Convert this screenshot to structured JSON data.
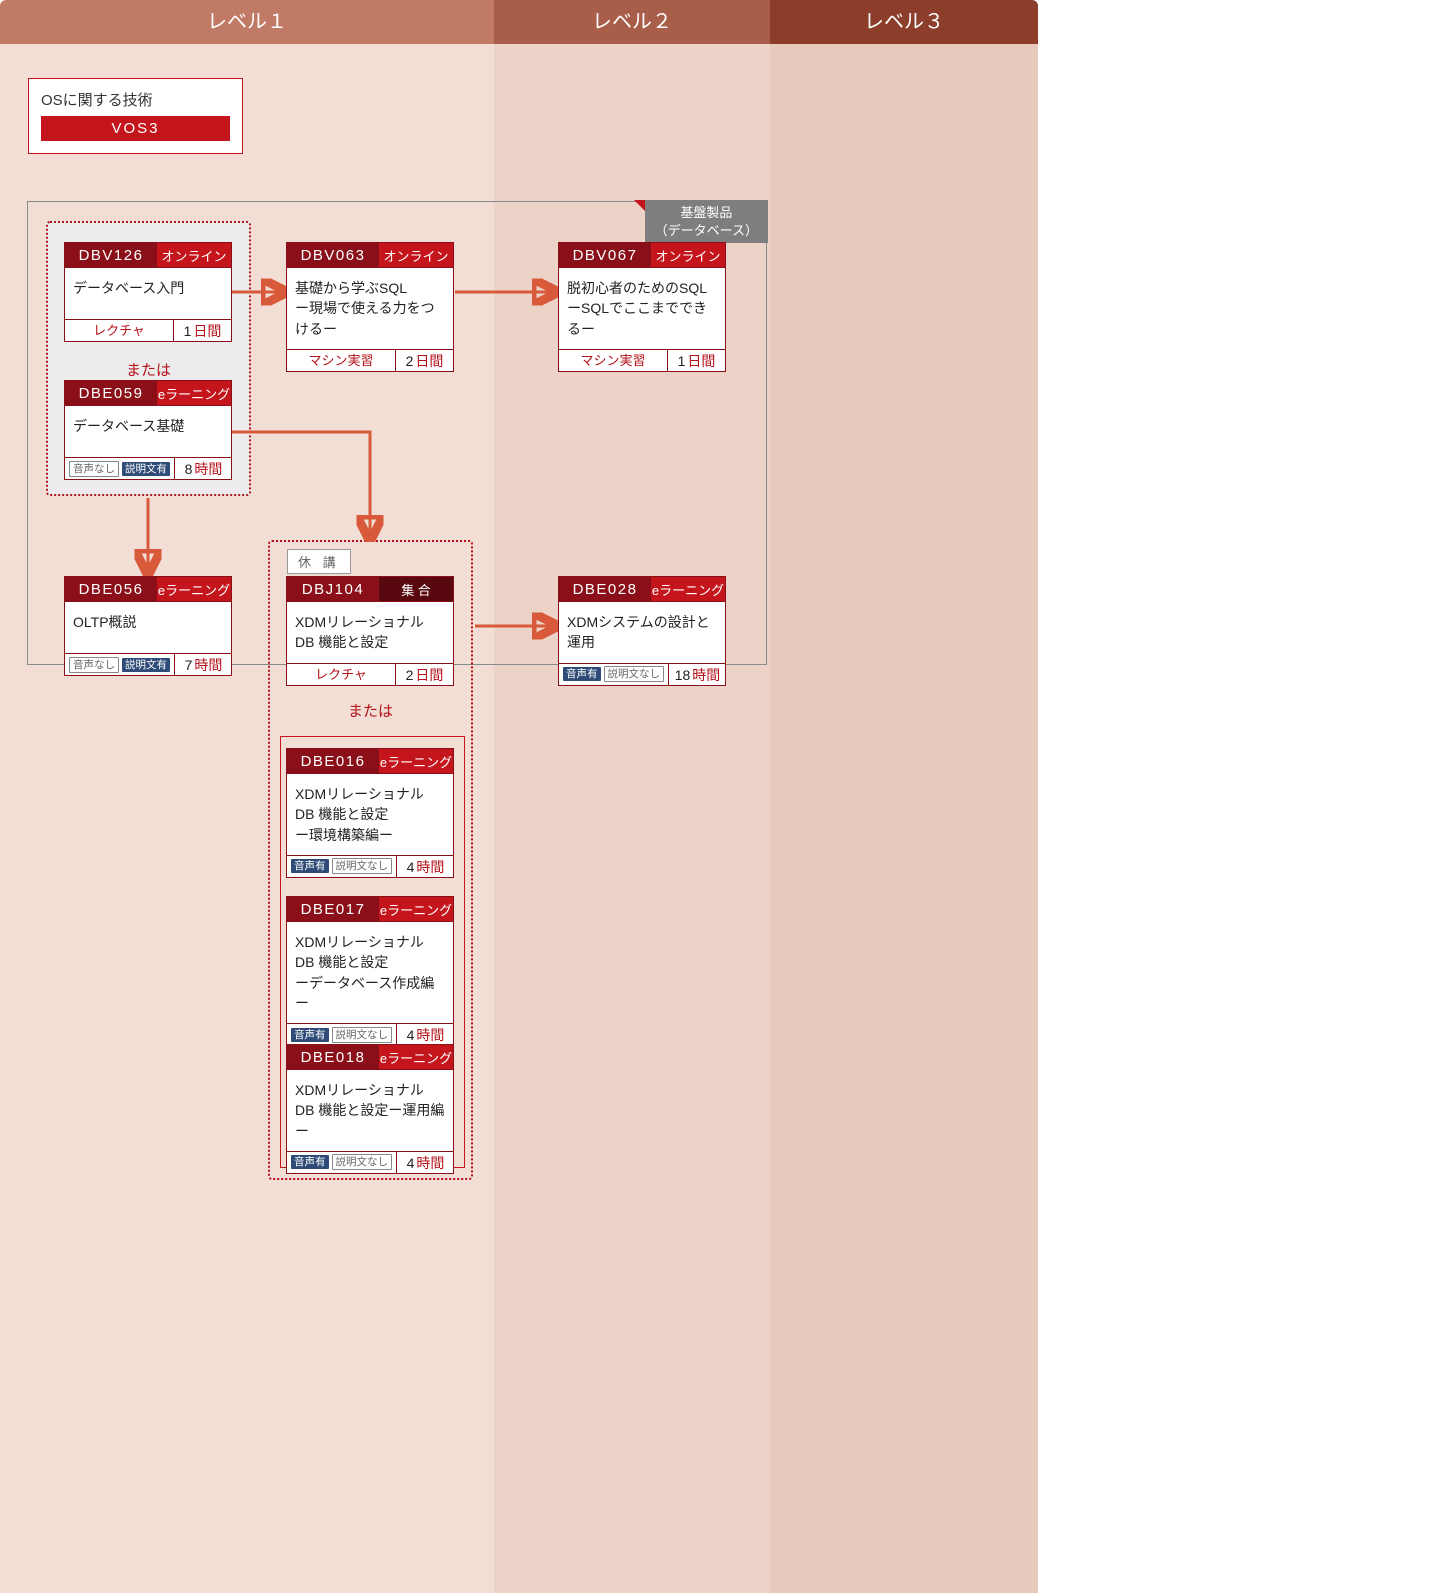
{
  "levels": {
    "l1": "レベル１",
    "l2": "レベル２",
    "l3": "レベル３"
  },
  "os_box": {
    "title": "OSに関する技術",
    "tag": "VOS3"
  },
  "container_label": {
    "line1": "基盤製品",
    "line2": "（データベース）"
  },
  "or_label": "または",
  "status_suspended": "休 講",
  "duration_units": {
    "days": "日間",
    "hours": "時間"
  },
  "cards": {
    "dbv126": {
      "code": "DBV126",
      "mode": "オンライン",
      "title": "データベース入門",
      "style": "レクチャ",
      "dur_n": "1",
      "dur_u": "days"
    },
    "dbe059": {
      "code": "DBE059",
      "mode": "eラーニング",
      "title": "データベース基礎",
      "audio": "none",
      "text": "yes",
      "dur_n": "8",
      "dur_u": "hours"
    },
    "dbv063": {
      "code": "DBV063",
      "mode": "オンライン",
      "title": "基礎から学ぶSQL\nー現場で使える力をつけるー",
      "style": "マシン実習",
      "dur_n": "2",
      "dur_u": "days"
    },
    "dbv067": {
      "code": "DBV067",
      "mode": "オンライン",
      "title": "脱初心者のためのSQL\nーSQLでここまでできるー",
      "style": "マシン実習",
      "dur_n": "1",
      "dur_u": "days"
    },
    "dbe056": {
      "code": "DBE056",
      "mode": "eラーニング",
      "title": "OLTP概説",
      "audio": "none",
      "text": "yes",
      "dur_n": "7",
      "dur_u": "hours"
    },
    "dbj104": {
      "code": "DBJ104",
      "mode": "集 合",
      "title": "XDMリレーショナル\nDB 機能と設定",
      "style": "レクチャ",
      "dur_n": "2",
      "dur_u": "days"
    },
    "dbe028": {
      "code": "DBE028",
      "mode": "eラーニング",
      "title": "XDMシステムの設計と運用",
      "audio": "yes",
      "text": "none",
      "dur_n": "18",
      "dur_u": "hours"
    },
    "dbe016": {
      "code": "DBE016",
      "mode": "eラーニング",
      "title": "XDMリレーショナル\nDB 機能と設定\nー環境構築編ー",
      "audio": "yes",
      "text": "none",
      "dur_n": "4",
      "dur_u": "hours"
    },
    "dbe017": {
      "code": "DBE017",
      "mode": "eラーニング",
      "title": "XDMリレーショナル\nDB 機能と設定\nーデータベース作成編ー",
      "audio": "yes",
      "text": "none",
      "dur_n": "4",
      "dur_u": "hours"
    },
    "dbe018": {
      "code": "DBE018",
      "mode": "eラーニング",
      "title": "XDMリレーショナル\nDB 機能と設定ー運用編ー",
      "audio": "yes",
      "text": "none",
      "dur_n": "4",
      "dur_u": "hours"
    }
  },
  "audio_labels": {
    "yes": "音声有",
    "none": "音声なし"
  },
  "text_labels": {
    "yes": "説明文有",
    "none": "説明文なし"
  }
}
